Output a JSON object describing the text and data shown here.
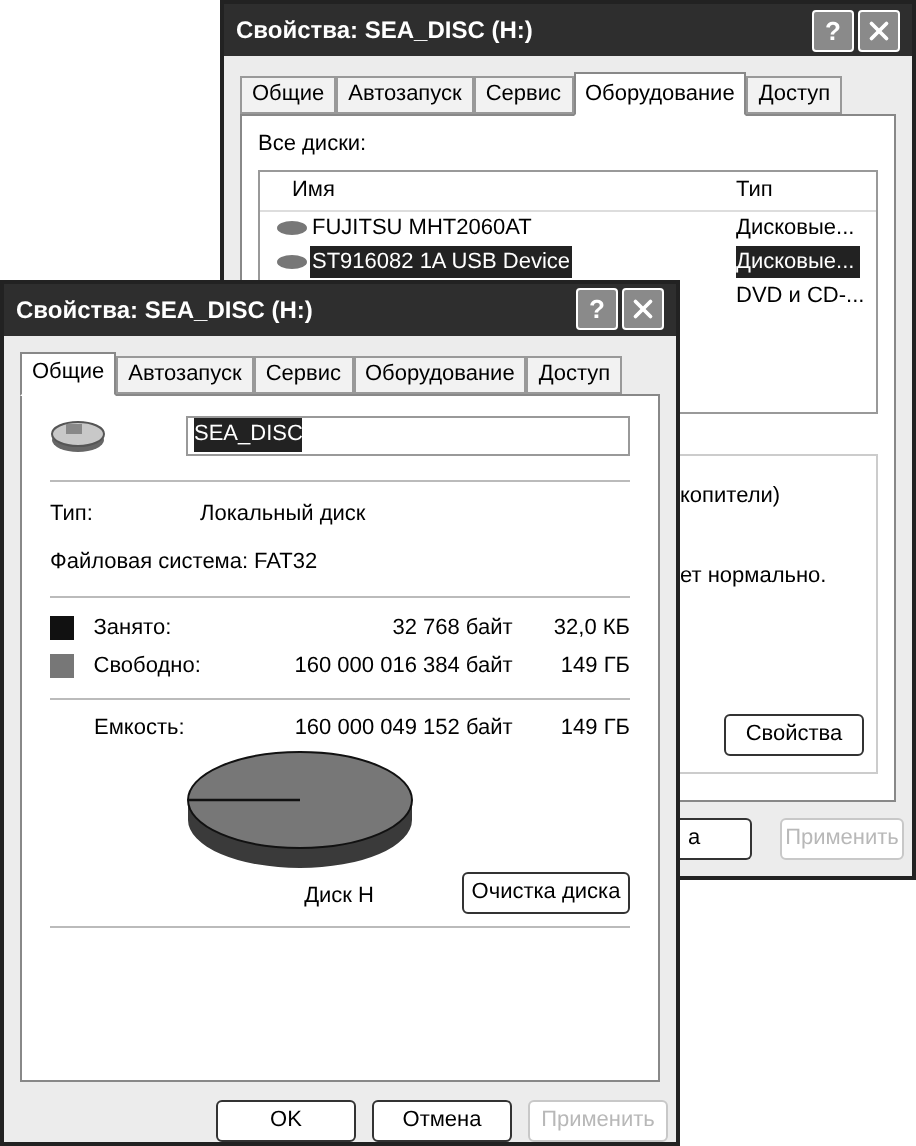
{
  "back_window": {
    "title": "Свойства: SEA_DISC (H:)",
    "help_button": "?",
    "tabs": [
      {
        "label": "Общие",
        "selected": false
      },
      {
        "label": "Автозапуск",
        "selected": false
      },
      {
        "label": "Сервис",
        "selected": false
      },
      {
        "label": "Оборудование",
        "selected": true
      },
      {
        "label": "Доступ",
        "selected": false
      }
    ],
    "list_label": "Все диски:",
    "list": {
      "columns": [
        "Имя",
        "Тип"
      ],
      "rows": [
        {
          "name": "FUJITSU MHT2060AT",
          "type": "Дисковые...",
          "selected": false
        },
        {
          "name": "ST916082 1A USB Device",
          "type": "Дисковые...",
          "selected": true
        },
        {
          "type": "DVD и CD-...",
          "selected": false
        }
      ]
    },
    "details": [
      "копители)",
      "ет нормально."
    ],
    "properties_button": "Свойства",
    "buttons": [
      {
        "label": "а",
        "disabled": false
      },
      {
        "label": "Применить",
        "disabled": true
      }
    ]
  },
  "front_window": {
    "title": "Свойства: SEA_DISC (H:)",
    "help_button": "?",
    "tabs": [
      {
        "label": "Общие",
        "selected": true
      },
      {
        "label": "Автозапуск",
        "selected": false
      },
      {
        "label": "Сервис",
        "selected": false
      },
      {
        "label": "Оборудование",
        "selected": false
      },
      {
        "label": "Доступ",
        "selected": false
      }
    ],
    "volume_name": "SEA_DISC",
    "type_label": "Тип:",
    "type_value": "Локальный диск",
    "fs_label": "Файловая система:",
    "fs_value": "FAT32",
    "usage": [
      {
        "label": "Занято:",
        "bytes": "32 768 байт",
        "size": "32,0 КБ",
        "color": "#111111"
      },
      {
        "label": "Свободно:",
        "bytes": "160 000 016 384 байт",
        "size": "149 ГБ",
        "color": "#777777"
      }
    ],
    "capacity": {
      "label": "Емкость:",
      "bytes": "160 000 049 152 байт",
      "size": "149 ГБ"
    },
    "disk_label": "Диск H",
    "cleanup_button": "Очистка диска",
    "buttons": [
      {
        "label": "OK",
        "disabled": false
      },
      {
        "label": "Отмена",
        "disabled": false
      },
      {
        "label": "Применить",
        "disabled": true
      }
    ]
  }
}
